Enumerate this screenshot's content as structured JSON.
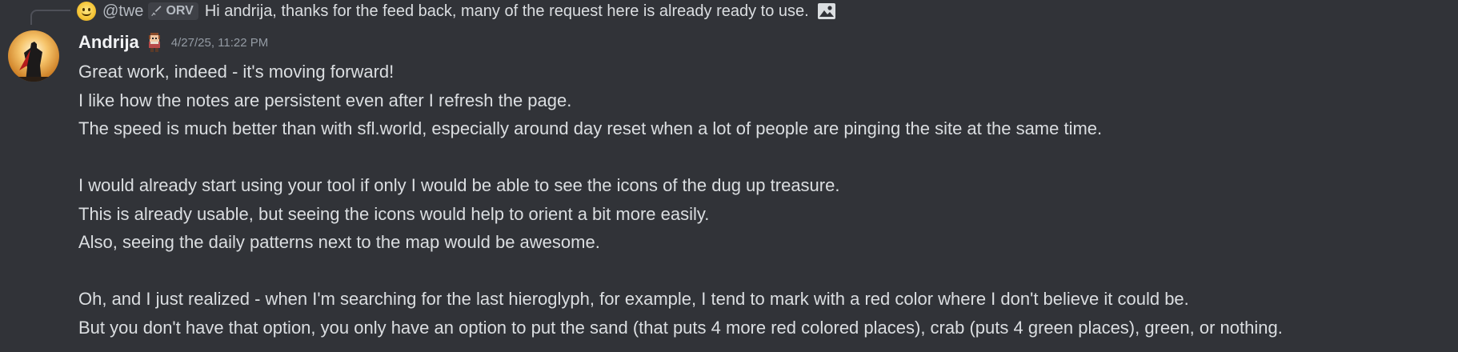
{
  "reply": {
    "author": "@twe",
    "tag": "ORV",
    "text": "Hi andrija, thanks for the feed back, many of the request here is already ready to use."
  },
  "message": {
    "username": "Andrija",
    "timestamp": "4/27/25, 11:22 PM",
    "lines": [
      "Great work, indeed - it's moving forward!",
      "I like how the notes are persistent even after I refresh the page.",
      "The speed is much better than with sfl.world, especially around day reset when a lot of people are pinging the site at the same time.",
      "",
      "I would already start using your tool if only I would be able to see the icons of the dug up treasure.",
      "This is already usable, but seeing the icons would help to orient a bit more easily.",
      "Also, seeing the daily patterns next to the map would be awesome.",
      "",
      "Oh, and I just realized - when I'm searching for the last hieroglyph, for example, I tend to mark with a red color where I don't believe it could be.",
      "But you don't have that option, you only have an option to put the sand (that puts 4 more red colored places), crab (puts 4 green places), green, or nothing."
    ]
  },
  "colors": {
    "background": "#313338",
    "text": "#dbdee1",
    "username": "#f2f3f5",
    "muted": "#949ba4"
  },
  "icons": {
    "reply_avatar": "smiley-face-icon",
    "tag_icon": "sword-icon",
    "attachment": "image-icon",
    "avatar": "superhero-avatar",
    "badge": "pixel-character-icon"
  }
}
